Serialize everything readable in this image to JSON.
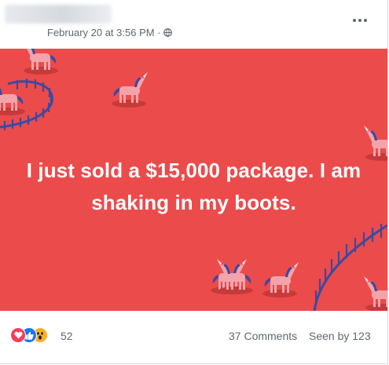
{
  "post": {
    "author": "",
    "timestamp": "February 20 at 3:56 PM",
    "separator": "·",
    "privacy_icon": "globe-icon",
    "more_icon": "more-options-icon",
    "text": "I just sold a $15,000 package. I am shaking in my boots.",
    "background_color": "#ec4b4b",
    "background_theme": "unicorns-and-fences"
  },
  "footer": {
    "reactions": [
      "love",
      "like",
      "wow"
    ],
    "reaction_count": "52",
    "comments": "37 Comments",
    "seen_by": "Seen by 123"
  },
  "colors": {
    "love": "#f33e58",
    "like": "#1877f2",
    "wow": "#f7b125",
    "meta_text": "#606770",
    "fence": "#3b4aa0",
    "unicorn": "#f4a3aa"
  }
}
